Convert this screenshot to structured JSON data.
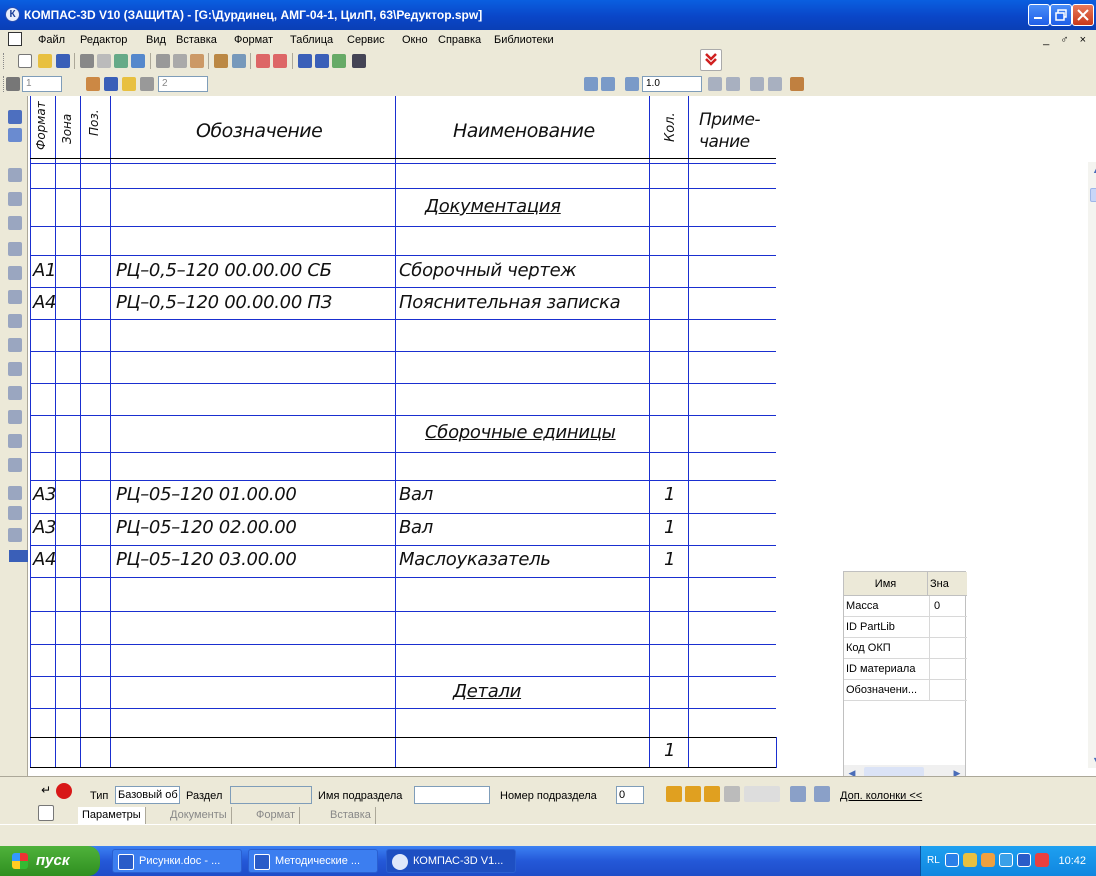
{
  "window": {
    "title": "КОМПАС-3D V10 (ЗАЩИТА) - [G:\\Дурдинец, АМГ-04-1, ЦилП, 63\\Редуктор.spw]"
  },
  "menu": {
    "items": [
      "Файл",
      "Редактор",
      "Вид",
      "Вставка",
      "Формат",
      "Таблица",
      "Сервис",
      "Окно",
      "Справка",
      "Библиотеки"
    ],
    "window_controls": "_ ♂ ×"
  },
  "toolbar": {
    "field1": "1",
    "field2": "2",
    "zoom": "1.0"
  },
  "spec": {
    "headers": {
      "format": "Формат",
      "zone": "Зона",
      "pos": "Поз.",
      "designation": "Обозначение",
      "name": "Наименование",
      "qty": "Кол.",
      "note1": "Приме-",
      "note2": "чание"
    },
    "sections": {
      "docs": "Документация",
      "units": "Сборочные единицы",
      "parts": "Детали"
    },
    "docs": [
      {
        "format": "А1",
        "designation": "РЦ–0,5–120 00.00.00 СБ",
        "name": "Сборочный чертеж"
      },
      {
        "format": "А4",
        "designation": "РЦ–0,5–120 00.00.00 ПЗ",
        "name": "Пояснительная записка"
      }
    ],
    "units": [
      {
        "format": "А3",
        "designation": "РЦ–05–120 01.00.00",
        "name": "Вал",
        "qty": "1"
      },
      {
        "format": "А3",
        "designation": "РЦ–05–120 02.00.00",
        "name": "Вал",
        "qty": "1"
      },
      {
        "format": "А4",
        "designation": "РЦ–05–120 03.00.00",
        "name": "Маслоуказатель",
        "qty": "1"
      }
    ],
    "last_qty": "1"
  },
  "properties": {
    "col_name": "Имя",
    "col_value": "Зна",
    "rows": [
      {
        "name": "Масса",
        "value": "0"
      },
      {
        "name": "ID PartLib",
        "value": ""
      },
      {
        "name": "Код ОКП",
        "value": ""
      },
      {
        "name": "ID материала",
        "value": ""
      },
      {
        "name": "Обозначени...",
        "value": ""
      }
    ]
  },
  "propbar": {
    "type_label": "Тип",
    "type_value": "Базовый об",
    "section_label": "Раздел",
    "subsection_name_label": "Имя подраздела",
    "subsection_num_label": "Номер подраздела",
    "subsection_num_value": "0",
    "extra_columns": "Доп. колонки  <<",
    "tabs": [
      "Параметры",
      "Документы",
      "Формат",
      "Вставка"
    ]
  },
  "taskbar": {
    "start": "пуск",
    "tasks": [
      "Рисунки.doc - ...",
      "Методические ...",
      "КОМПАС-3D V1..."
    ],
    "lang": "RL",
    "clock": "10:42"
  }
}
